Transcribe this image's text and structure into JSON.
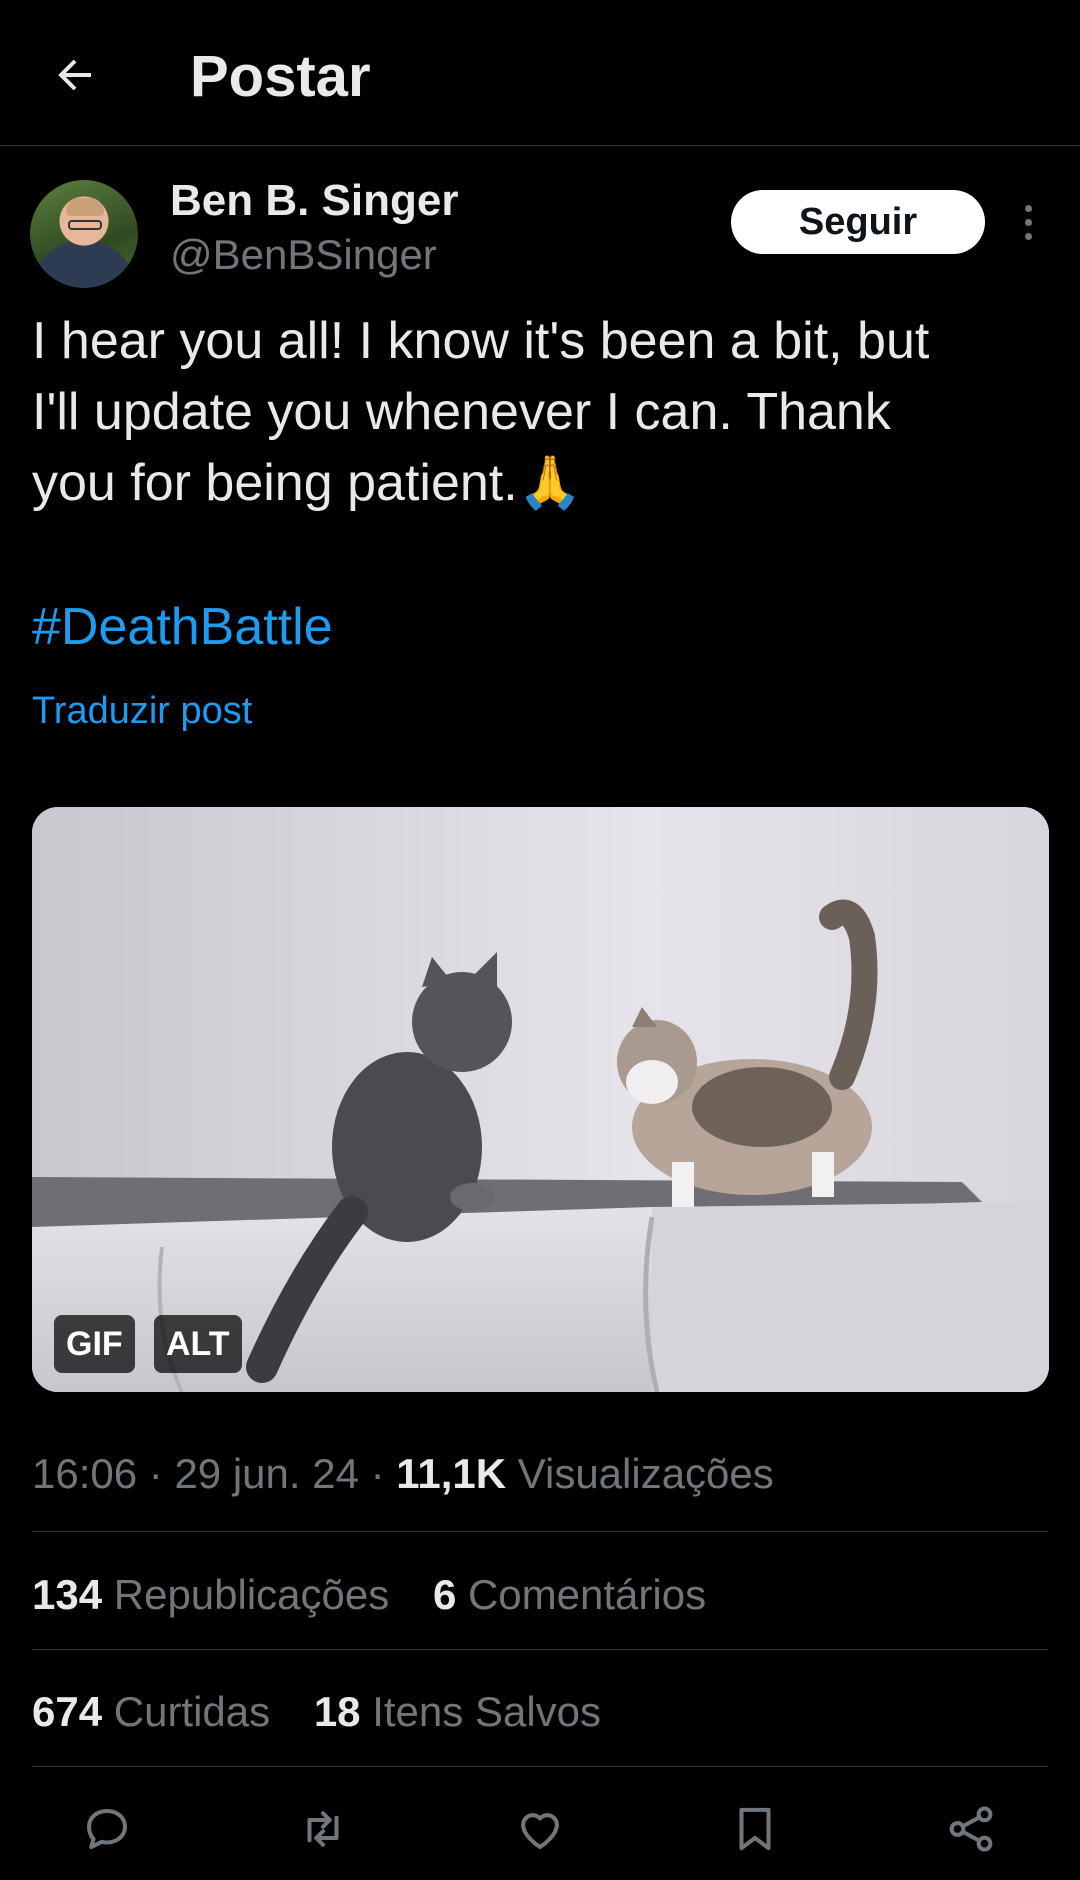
{
  "header": {
    "title": "Postar"
  },
  "author": {
    "name": "Ben B. Singer",
    "handle": "@BenBSinger",
    "follow_label": "Seguir"
  },
  "post": {
    "text": "I hear you all! I know it's been a bit, but\nI'll update you whenever I can. Thank\nyou for being patient.🙏",
    "hashtag": "#DeathBattle",
    "translate_label": "Traduzir post"
  },
  "media": {
    "gif_badge": "GIF",
    "alt_badge": "ALT"
  },
  "meta": {
    "time": "16:06",
    "date": "29 jun. 24",
    "views_count": "11,1K",
    "views_label": "Visualizações",
    "separator": "·"
  },
  "stats": {
    "reposts_count": "134",
    "reposts_label": "Republicações",
    "comments_count": "6",
    "comments_label": "Comentários",
    "likes_count": "674",
    "likes_label": "Curtidas",
    "saves_count": "18",
    "saves_label": "Itens Salvos"
  },
  "actions": [
    "reply-icon",
    "repost-icon",
    "like-icon",
    "bookmark-icon",
    "share-icon"
  ],
  "colors": {
    "background": "#000000",
    "text": "#e7e9ea",
    "secondary": "#71767b",
    "accent": "#1d9bf0",
    "divider": "#2f3336"
  }
}
